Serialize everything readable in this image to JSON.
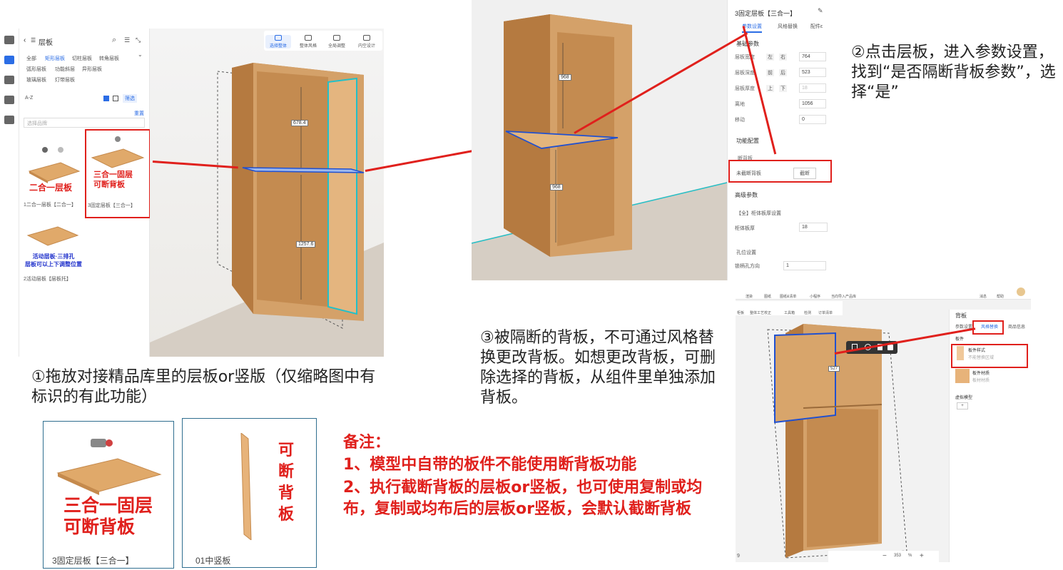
{
  "scene1": {
    "panel_title": "层板",
    "categories": [
      "全部",
      "矩形层板",
      "切柱层板",
      "转角层板",
      "弧形层板",
      "功能斜层",
      "异形层板",
      "玻璃层板",
      "灯带层板"
    ],
    "sort_label": "A-Z",
    "filter_label": "筛选",
    "reset_label": "重置",
    "select_placeholder": "选择品牌",
    "items": [
      {
        "overlay": "二合一层板",
        "caption": "1二合一层板【二合一】"
      },
      {
        "overlay": "三合一固层\n可断背板",
        "caption": "3固定层板【三合一】"
      },
      {
        "overlay": "活动层板·三排孔\n层板可以上下调整位置",
        "caption": "2活动层板【层板托】"
      }
    ],
    "toolbar": [
      {
        "label": "选择整体"
      },
      {
        "label": "整体风格"
      },
      {
        "label": "全局调整"
      },
      {
        "label": "内空设计"
      }
    ],
    "dims": [
      "678.4",
      "1257.6"
    ]
  },
  "scene2": {
    "prop_title": "3固定层板【三合一】",
    "tabs": [
      "参数设置",
      "风格替换",
      "配件ε"
    ],
    "section_basic": "基础参数",
    "rows": [
      {
        "label": "层板宽度",
        "opt1": "左",
        "opt2": "右",
        "value": "764"
      },
      {
        "label": "层板深度",
        "opt1": "前",
        "opt2": "后",
        "value": "523"
      },
      {
        "label": "层板厚度",
        "opt1": "上",
        "opt2": "下",
        "value": "18"
      },
      {
        "label": "离地",
        "opt1": "",
        "opt2": "",
        "value": "1056"
      },
      {
        "label": "移动",
        "opt1": "",
        "opt2": "",
        "value": "0"
      }
    ],
    "section_func": "功能配置",
    "subsection": "断背板",
    "break_label": "未截断背板",
    "break_button": "截断",
    "section_adv": "高级参数",
    "board_thick_title": "【全】柜体板厚设置",
    "board_thick_label": "柜体板厚",
    "board_thick_value": "18",
    "hole_title": "孔位设置",
    "hole_label": "锁柄孔方向",
    "hole_value": "1",
    "dims": [
      "968",
      "968"
    ]
  },
  "scene3": {
    "toolbar": [
      "渲染",
      "图纸",
      "图纸&清单",
      "小程序",
      "当向导入产品库",
      "消息",
      "帮助"
    ],
    "toolbar2": [
      "柜板",
      "整体工艺校正",
      "工具箱",
      "检测",
      "订单清单"
    ],
    "prop_title": "背板",
    "tabs": [
      "参数设置",
      "风格替换",
      "商品信息"
    ],
    "section": "板件",
    "styles": [
      {
        "title": "板件样式",
        "sub": "不能替换区域"
      },
      {
        "title": "板件材质",
        "sub": "板材材质"
      }
    ],
    "virtual": "虚拟模型",
    "dim": "527",
    "zoom": "353",
    "zoom_unit": "%",
    "page": "9"
  },
  "annotations": {
    "step1": "①拖放对接精品库里的层板or竖版（仅缩略图中有标识的有此功能）",
    "step2": "②点击层板，进入参数设置，找到“是否隔断背板参数”，选择“是”",
    "step3": "③被隔断的背板，不可通过风格替换更改背板。如想更改背板，可删除选择的背板，从组件里单独添加背板。",
    "note_title": "备注：",
    "note1": "1、模型中自带的板件不能使用断背板功能",
    "note2": "2、执行截断背板的层板or竖板，也可使用复制或均布，复制或均布后的层板or竖板，会默认截断背板"
  },
  "cards": [
    {
      "overlay": "三合一固层\n可断背板",
      "caption": "3固定层板【三合一】"
    },
    {
      "overlay": "可断背板",
      "caption": "01中竖板"
    }
  ],
  "colors": {
    "accent": "#2b6de5",
    "annotation_red": "#e0201c",
    "wood": "#d9a066"
  }
}
